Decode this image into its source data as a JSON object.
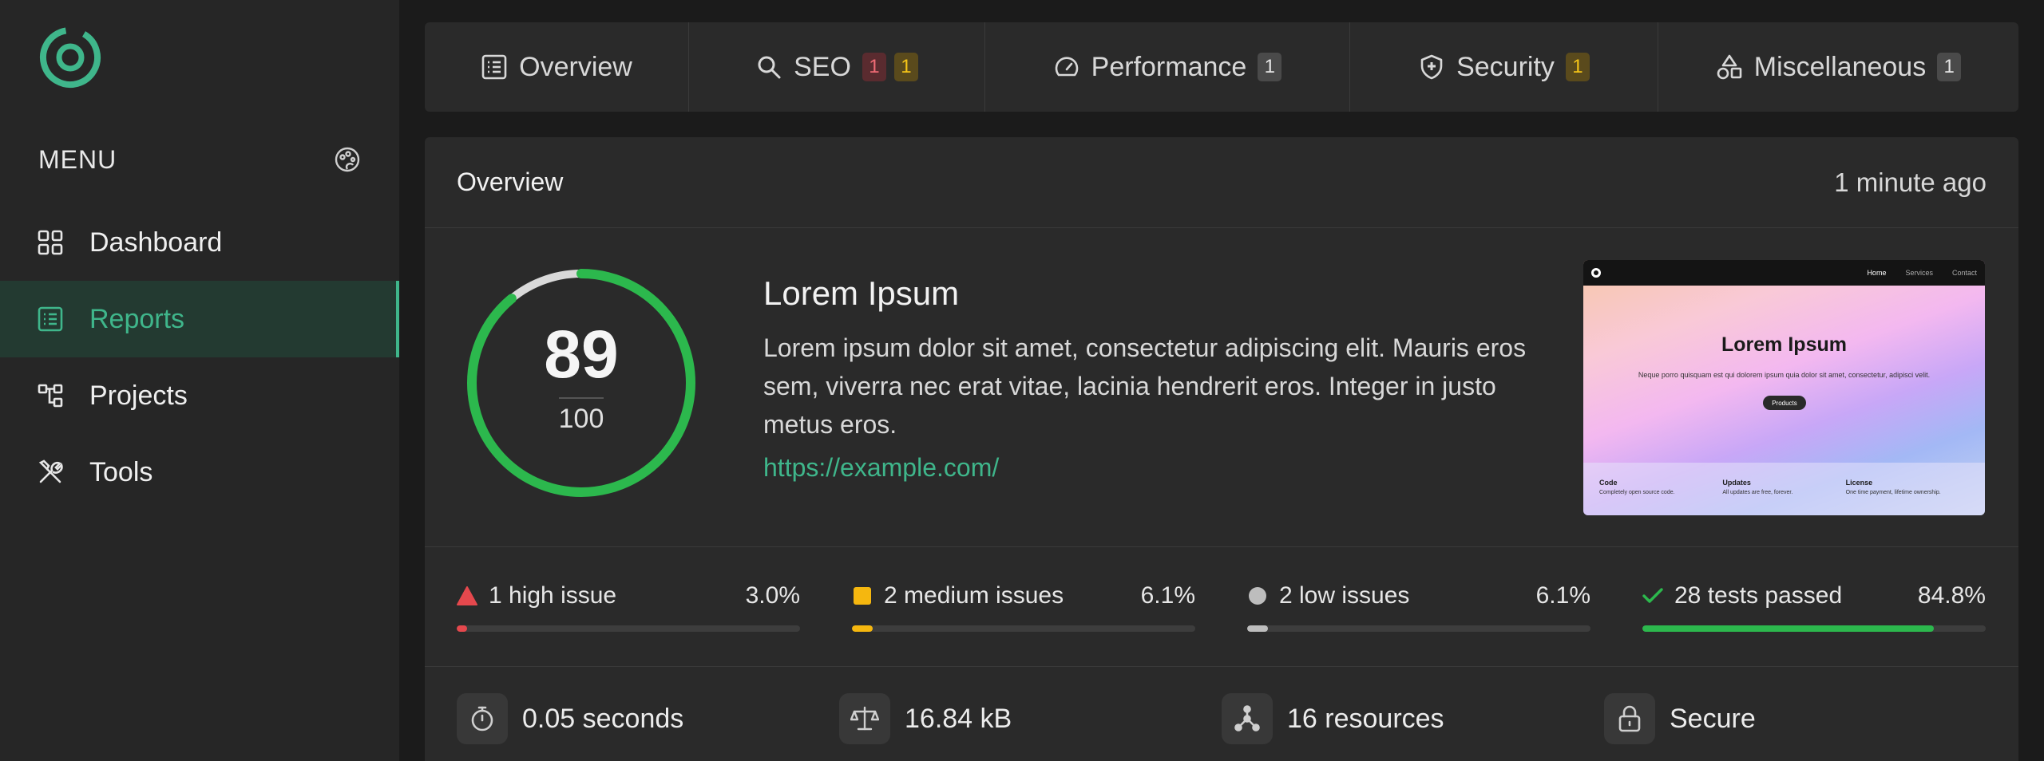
{
  "sidebar": {
    "menu_title": "MENU",
    "items": [
      {
        "label": "Dashboard",
        "icon": "grid-icon"
      },
      {
        "label": "Reports",
        "icon": "list-icon",
        "active": true
      },
      {
        "label": "Projects",
        "icon": "hierarchy-icon"
      },
      {
        "label": "Tools",
        "icon": "tools-icon"
      }
    ]
  },
  "tabs": [
    {
      "label": "Overview",
      "icon": "report-icon",
      "badges": []
    },
    {
      "label": "SEO",
      "icon": "search-icon",
      "badges": [
        "1",
        "1"
      ]
    },
    {
      "label": "Performance",
      "icon": "speedometer-icon",
      "badges": [
        "1"
      ]
    },
    {
      "label": "Security",
      "icon": "shield-icon",
      "badges": [
        "1"
      ]
    },
    {
      "label": "Miscellaneous",
      "icon": "shapes-icon",
      "badges": [
        "1"
      ]
    }
  ],
  "overview": {
    "title": "Overview",
    "time": "1 minute ago",
    "score": "89",
    "max": "100",
    "score_fraction": 0.89,
    "site_title": "Lorem Ipsum",
    "site_description": "Lorem ipsum dolor sit amet, consectetur adipiscing elit. Mauris eros sem, viverra nec erat vitae, lacinia hendrerit eros. Integer in justo metus eros.",
    "site_url": "https://example.com/"
  },
  "preview": {
    "nav_links": [
      "Home",
      "Services",
      "Contact"
    ],
    "title": "Lorem Ipsum",
    "subtitle": "Neque porro quisquam est qui dolorem ipsum quia dolor sit amet, consectetur, adipisci velit.",
    "button": "Products",
    "footer": [
      {
        "heading": "Code",
        "text": "Completely open source code."
      },
      {
        "heading": "Updates",
        "text": "All updates are free, forever."
      },
      {
        "heading": "License",
        "text": "One time payment, lifetime ownership."
      }
    ]
  },
  "issues": [
    {
      "label": "1 high issue",
      "percent": "3.0%",
      "value": 3.0,
      "color": "#e5484d",
      "icon": "triangle-icon"
    },
    {
      "label": "2 medium issues",
      "percent": "6.1%",
      "value": 6.1,
      "color": "#f5b70f",
      "icon": "square-icon"
    },
    {
      "label": "2 low issues",
      "percent": "6.1%",
      "value": 6.1,
      "color": "#bdbdbd",
      "icon": "circle-icon"
    },
    {
      "label": "28 tests passed",
      "percent": "84.8%",
      "value": 84.8,
      "color": "#2cb84d",
      "icon": "check-icon"
    }
  ],
  "stats": [
    {
      "label": "0.05 seconds",
      "icon": "timer-icon"
    },
    {
      "label": "16.84 kB",
      "icon": "scale-icon"
    },
    {
      "label": "16 resources",
      "icon": "nodes-icon"
    },
    {
      "label": "Secure",
      "icon": "lock-icon"
    }
  ],
  "colors": {
    "accent": "#3fb68b",
    "gauge": "#2cb84d",
    "sidebar": "#262626",
    "panel": "#2a2a2a"
  }
}
